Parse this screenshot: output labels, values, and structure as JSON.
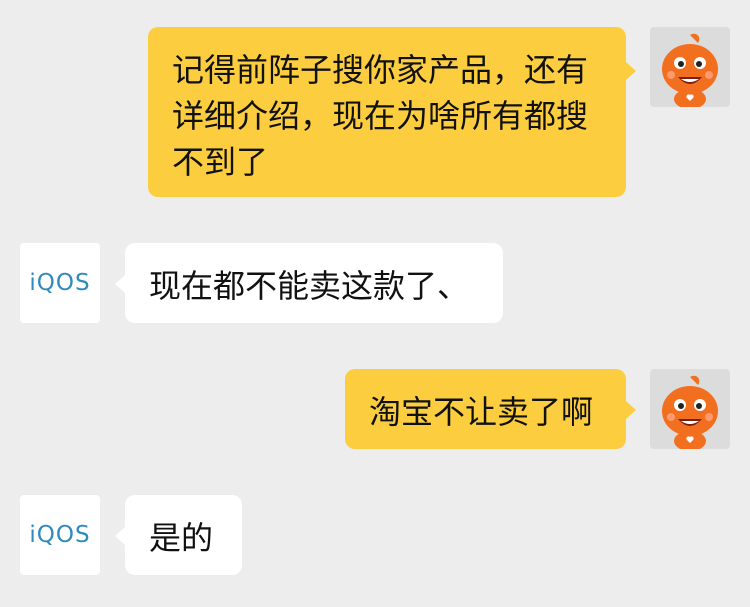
{
  "colors": {
    "background": "#ededed",
    "my_bubble": "#fbcd3f",
    "other_bubble": "#ffffff",
    "brand_text": "#2f8bbd"
  },
  "contact": {
    "avatar_text": "iQOS"
  },
  "messages": [
    {
      "sender": "me",
      "text": "记得前阵子搜你家产品，还有详细介绍，现在为啥所有都搜不到了"
    },
    {
      "sender": "other",
      "text": "现在都不能卖这款了、"
    },
    {
      "sender": "me",
      "text": "淘宝不让卖了啊"
    },
    {
      "sender": "other",
      "text": "是的"
    }
  ]
}
